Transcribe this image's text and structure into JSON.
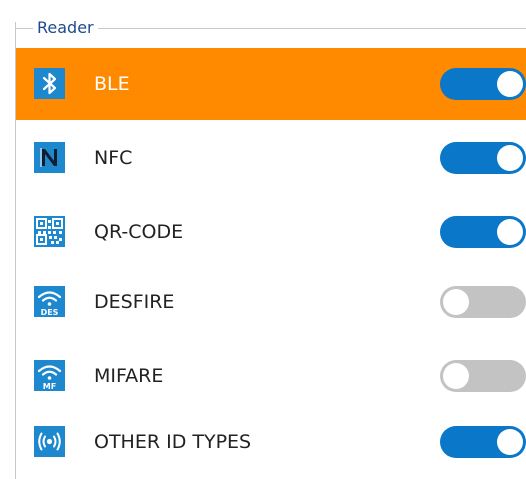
{
  "group": {
    "title": "Reader"
  },
  "colors": {
    "selected_row": "#ff8a00",
    "icon_background": "#1e88cf",
    "toggle_on": "#0a77c8",
    "toggle_off": "#c3c3c3"
  },
  "readers": [
    {
      "label": "BLE",
      "icon": "bluetooth-icon",
      "enabled": true,
      "selected": true
    },
    {
      "label": "NFC",
      "icon": "nfc-icon",
      "enabled": true,
      "selected": false
    },
    {
      "label": "QR-CODE",
      "icon": "qr-code-icon",
      "enabled": true,
      "selected": false
    },
    {
      "label": "DESFIRE",
      "icon": "desfire-icon",
      "enabled": false,
      "selected": false
    },
    {
      "label": "MIFARE",
      "icon": "mifare-icon",
      "enabled": false,
      "selected": false
    },
    {
      "label": "OTHER ID TYPES",
      "icon": "broadcast-icon",
      "enabled": true,
      "selected": false
    }
  ]
}
